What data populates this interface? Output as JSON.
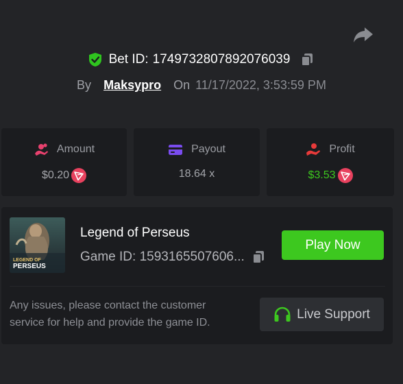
{
  "bet": {
    "id_label": "Bet ID:",
    "id_value": "1749732807892076039",
    "by_label": "By",
    "username": "Maksypro",
    "on_label": "On",
    "date": "11/17/2022, 3:53:59 PM"
  },
  "stats": {
    "amount": {
      "label": "Amount",
      "value": "$0.20"
    },
    "payout": {
      "label": "Payout",
      "value": "18.64 x"
    },
    "profit": {
      "label": "Profit",
      "value": "$3.53"
    }
  },
  "game": {
    "title": "Legend of Perseus",
    "id_label": "Game ID:",
    "id_value": "1593165507606...",
    "thumb_text_line1": "LEGEND OF",
    "thumb_text_line2": "PERSEUS",
    "play_label": "Play Now"
  },
  "support": {
    "text": "Any issues, please contact the customer service for help and provide the game ID.",
    "button_label": "Live Support"
  },
  "colors": {
    "background": "#232427",
    "card": "#1b1c1f",
    "accent_green": "#3dc81f",
    "coin_red": "#e8415e",
    "amount_icon": "#e8416e",
    "payout_icon": "#7a4cf0",
    "profit_icon": "#e83a3a"
  },
  "icons": [
    "share-icon",
    "shield-check-icon",
    "copy-icon",
    "coins-icon",
    "card-icon",
    "hand-user-icon",
    "tron-coin-icon",
    "headset-icon"
  ]
}
